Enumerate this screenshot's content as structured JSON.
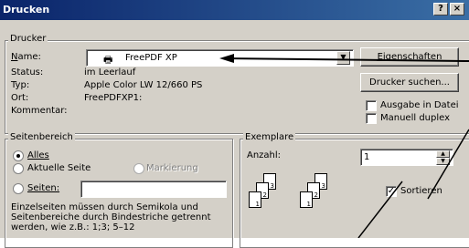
{
  "window": {
    "title": "Drucken",
    "help_btn": "?",
    "close_btn": "×"
  },
  "printer": {
    "group_label": "Drucker",
    "name_label": "Name:",
    "name_value": "FreePDF XP",
    "status_label": "Status:",
    "status_value": "im Leerlauf",
    "type_label": "Typ:",
    "type_value": "Apple Color LW 12/660 PS",
    "location_label": "Ort:",
    "location_value": "FreePDFXP1:",
    "comment_label": "Kommentar:",
    "properties_btn": "Eigenschaften",
    "find_btn": "Drucker suchen...",
    "print_to_file": "Ausgabe in Datei",
    "manual_duplex": "Manuell duplex"
  },
  "range": {
    "group_label": "Seitenbereich",
    "all": "Alles",
    "current": "Aktuelle Seite",
    "selection": "Markierung",
    "pages": "Seiten:",
    "hint1": "Einzelseiten müssen durch Semikola und",
    "hint2": "Seitenbereiche durch Bindestriche getrennt",
    "hint3": "werden, wie z.B.: 1;3; 5–12"
  },
  "copies": {
    "group_label": "Exemplare",
    "count_label": "Anzahl:",
    "count_value": "1",
    "collate": "Sortieren",
    "page_nums": [
      "3",
      "2",
      "1"
    ]
  }
}
